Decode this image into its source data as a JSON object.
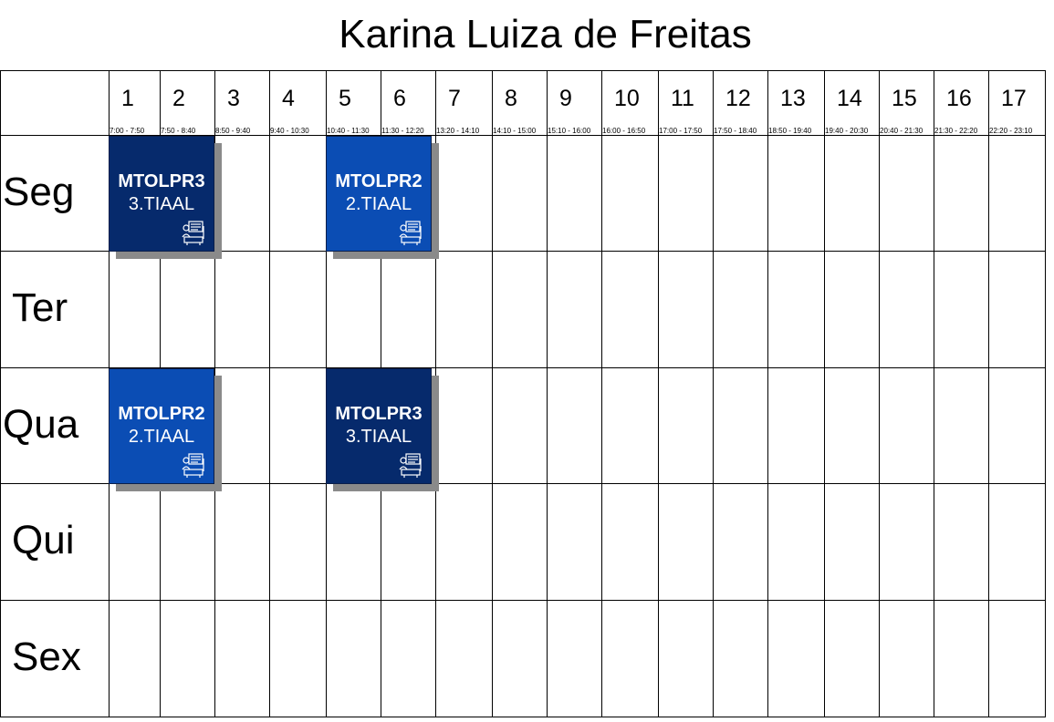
{
  "title": "Karina Luiza de Freitas",
  "periods": [
    {
      "num": "1",
      "time": "7:00 - 7:50"
    },
    {
      "num": "2",
      "time": "7:50 - 8:40"
    },
    {
      "num": "3",
      "time": "8:50 - 9:40"
    },
    {
      "num": "4",
      "time": "9:40 - 10:30"
    },
    {
      "num": "5",
      "time": "10:40 - 11:30"
    },
    {
      "num": "6",
      "time": "11:30 - 12:20"
    },
    {
      "num": "7",
      "time": "13:20 - 14:10"
    },
    {
      "num": "8",
      "time": "14:10 - 15:00"
    },
    {
      "num": "9",
      "time": "15:10 - 16:00"
    },
    {
      "num": "10",
      "time": "16:00 - 16:50"
    },
    {
      "num": "11",
      "time": "17:00 - 17:50"
    },
    {
      "num": "12",
      "time": "17:50 - 18:40"
    },
    {
      "num": "13",
      "time": "18:50 - 19:40"
    },
    {
      "num": "14",
      "time": "19:40 - 20:30"
    },
    {
      "num": "15",
      "time": "20:40 - 21:30"
    },
    {
      "num": "16",
      "time": "21:30 - 22:20"
    },
    {
      "num": "17",
      "time": "22:20 - 23:10"
    }
  ],
  "days": [
    "Seg",
    "Ter",
    "Qua",
    "Qui",
    "Sex"
  ],
  "classes": [
    {
      "day": "Seg",
      "periods": [
        "1",
        "2"
      ],
      "code": "MTOLPR3",
      "group": "3.TIAAL",
      "color": "#062a6c",
      "icon": "teacher-desk-icon"
    },
    {
      "day": "Seg",
      "periods": [
        "5",
        "6"
      ],
      "code": "MTOLPR2",
      "group": "2.TIAAL",
      "color": "#0b4db4",
      "icon": "teacher-desk-icon"
    },
    {
      "day": "Qua",
      "periods": [
        "1",
        "2"
      ],
      "code": "MTOLPR2",
      "group": "2.TIAAL",
      "color": "#0b4db4",
      "icon": "teacher-desk-icon"
    },
    {
      "day": "Qua",
      "periods": [
        "5",
        "6"
      ],
      "code": "MTOLPR3",
      "group": "3.TIAAL",
      "color": "#062a6c",
      "icon": "teacher-desk-icon"
    }
  ],
  "colors": {
    "grid_line": "#000000",
    "shadow": "#8a8a8a"
  }
}
